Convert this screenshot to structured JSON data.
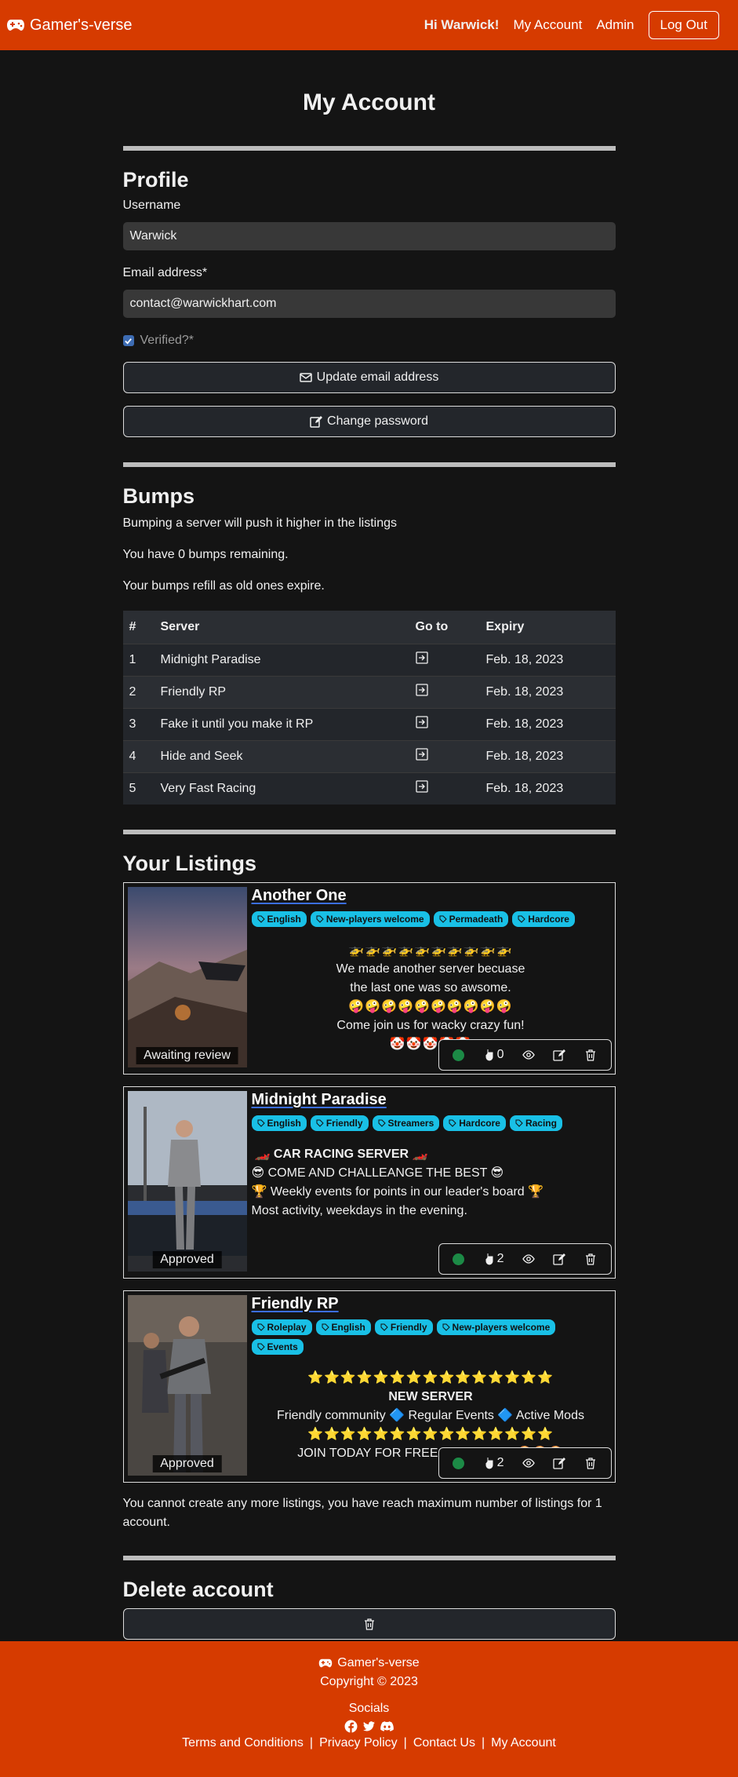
{
  "nav": {
    "brand": "Gamer's-verse",
    "greeting": "Hi Warwick!",
    "my_account": "My Account",
    "admin": "Admin",
    "logout": "Log Out"
  },
  "page_title": "My Account",
  "profile": {
    "heading": "Profile",
    "username_label": "Username",
    "username_value": "Warwick",
    "email_label": "Email address*",
    "email_value": "contact@warwickhart.com",
    "verified_label": "Verified?*",
    "update_email_button": "Update email address",
    "change_password_button": "Change password"
  },
  "bumps": {
    "heading": "Bumps",
    "line1": "Bumping a server will push it higher in the listings",
    "line2": "You have 0 bumps remaining.",
    "line3": "Your bumps refill as old ones expire.",
    "columns": [
      "#",
      "Server",
      "Go to",
      "Expiry"
    ],
    "rows": [
      {
        "n": "1",
        "server": "Midnight Paradise",
        "expiry": "Feb. 18, 2023"
      },
      {
        "n": "2",
        "server": "Friendly RP",
        "expiry": "Feb. 18, 2023"
      },
      {
        "n": "3",
        "server": "Fake it until you make it RP",
        "expiry": "Feb. 18, 2023"
      },
      {
        "n": "4",
        "server": "Hide and Seek",
        "expiry": "Feb. 18, 2023"
      },
      {
        "n": "5",
        "server": "Very Fast Racing",
        "expiry": "Feb. 18, 2023"
      }
    ]
  },
  "listings": {
    "heading": "Your Listings",
    "items": [
      {
        "title": "Another One",
        "status": "Awaiting review",
        "tags": [
          "English",
          "New-players welcome",
          "Permadeath",
          "Hardcore"
        ],
        "desc": [
          "🚁🚁🚁🚁🚁🚁🚁🚁🚁🚁",
          "We made another server becuase",
          "the last one was so awsome.",
          "🤪🤪🤪🤪🤪🤪🤪🤪🤪🤪",
          "Come join us for wacky crazy fun!",
          "🤡🤡🤡🤡🤡"
        ],
        "bumps": "0"
      },
      {
        "title": "Midnight Paradise",
        "status": "Approved",
        "tags": [
          "English",
          "Friendly",
          "Streamers",
          "Hardcore",
          "Racing"
        ],
        "desc": [
          "🏎️ CAR RACING SERVER 🏎️",
          "😎 COME AND CHALLEANGE THE BEST 😎",
          "🏆 Weekly events for points in our leader's board 🏆",
          "Most activity, weekdays in the evening."
        ],
        "bumps": "2"
      },
      {
        "title": "Friendly RP",
        "status": "Approved",
        "tags": [
          "Roleplay",
          "English",
          "Friendly",
          "New-players welcome",
          "Events"
        ],
        "desc": [
          "⭐⭐⭐⭐⭐⭐⭐⭐⭐⭐⭐⭐⭐⭐⭐",
          "NEW SERVER",
          "Friendly community 🔷 Regular Events 🔷 Active Mods",
          "⭐⭐⭐⭐⭐⭐⭐⭐⭐⭐⭐⭐⭐⭐⭐",
          "JOIN TODAY FOR FREE e-COOKIES! 🍪🍪🍪"
        ],
        "bumps": "2"
      }
    ],
    "max_note": "You cannot create any more listings, you have reach maximum number of listings for 1 account."
  },
  "delete_account": {
    "heading": "Delete account"
  },
  "footer": {
    "brand": "Gamer's-verse",
    "copyright": "Copyright © 2023",
    "socials": "Socials",
    "links": [
      "Terms and Conditions",
      "Privacy Policy",
      "Contact Us",
      "My Account"
    ]
  },
  "colors": {
    "accent": "#d63b00",
    "tag": "#19c0e6",
    "status_online": "#1c8a46"
  }
}
